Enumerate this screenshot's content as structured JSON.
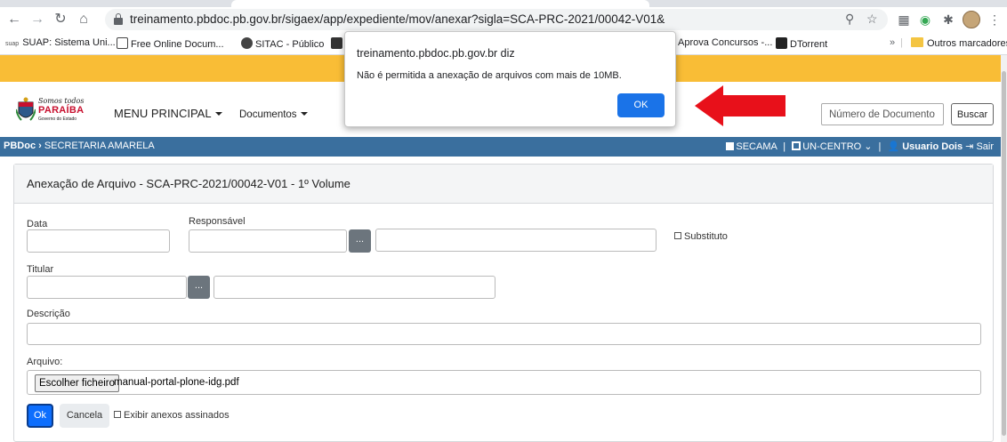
{
  "browser": {
    "url": "treinamento.pbdoc.pb.gov.br/sigaex/app/expediente/mov/anexar?sigla=SCA-PRC-2021/00042-V01&",
    "bookmarks": [
      "SUAP: Sistema Uni...",
      "Free Online Docum...",
      "SITAC - Público",
      "Aprova Concursos -...",
      "DTorrent"
    ],
    "bookmark_prefix": "suap",
    "more_bookmarks_chevron": "»",
    "other_bookmarks": "Outros marcadores"
  },
  "header": {
    "logo": {
      "line1": "Somos todos",
      "line2": "PARAÍBA",
      "line3": "Governo do Estado"
    },
    "menu_principal": "MENU PRINCIPAL",
    "menu_documentos": "Documentos",
    "search_placeholder": "Número de Documento",
    "search_button": "Buscar"
  },
  "navbar": {
    "brand": "PBDoc",
    "location": "SECRETARIA AMARELA",
    "org": "SECAMA",
    "unit": "UN-CENTRO",
    "user": "Usuario Dois",
    "logout": "Sair"
  },
  "form": {
    "title": "Anexação de Arquivo - SCA-PRC-2021/00042-V01 - 1º Volume",
    "data_label": "Data",
    "responsavel_label": "Responsável",
    "substituto_label": "Substituto",
    "titular_label": "Titular",
    "descricao_label": "Descrição",
    "arquivo_label": "Arquivo:",
    "choose_file_button": "Escolher ficheiro",
    "file_name": "manual-portal-plone-idg.pdf",
    "ok_button": "Ok",
    "cancel_button": "Cancela",
    "exibir_label": "Exibir anexos assinados",
    "lookup_button": "..."
  },
  "dialog": {
    "title": "treinamento.pbdoc.pb.gov.br diz",
    "message": "Não é permitida a anexação de arquivos com mais de 10MB.",
    "ok_button": "OK"
  },
  "colors": {
    "yellow_bar": "#f9bd36",
    "navbar": "#3a6f9e",
    "primary": "#0d6efd",
    "dialog_button": "#1a73e8",
    "arrow": "#e8101a"
  }
}
